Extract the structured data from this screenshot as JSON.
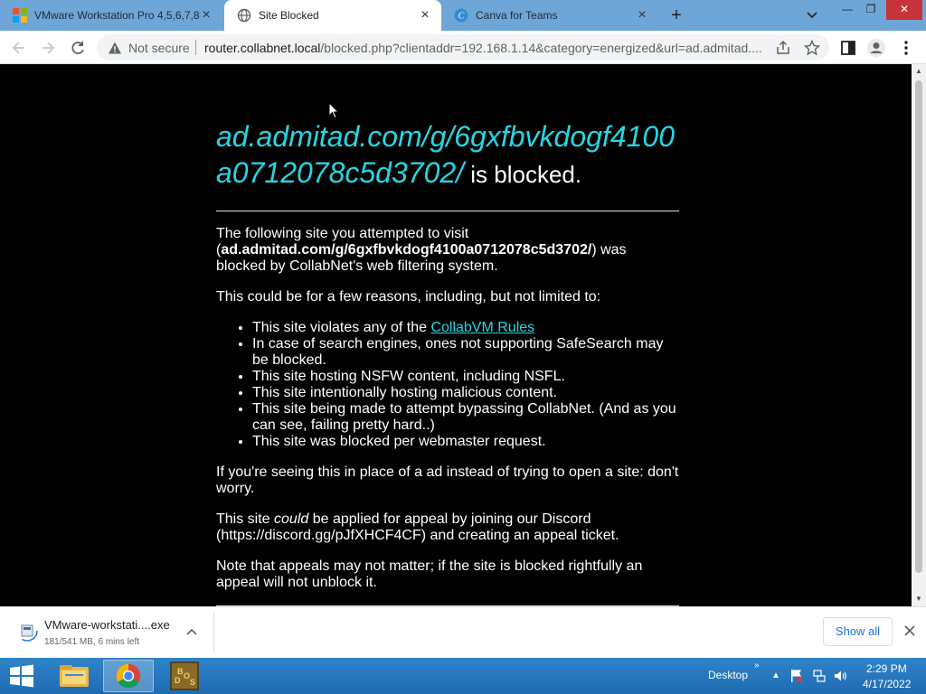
{
  "browser": {
    "tabs": [
      {
        "title": "VMware Workstation Pro 4,5,6,7,8",
        "active": false,
        "favicon": "vmware-icon"
      },
      {
        "title": "Site Blocked",
        "active": true,
        "favicon": "globe-icon"
      },
      {
        "title": "Canva for Teams",
        "active": false,
        "favicon": "canva-icon"
      }
    ],
    "new_tab_label": "+",
    "toolbar": {
      "not_secure_label": "Not secure",
      "url_host": "router.collabnet.local",
      "url_path": "/blocked.php?clientaddr=192.168.1.14&category=energized&url=ad.admitad...."
    }
  },
  "page": {
    "blocked_host": "ad.admitad.com/g/6gxfbvkdogf4100a0712078c5d3702/",
    "is_blocked_text": " is blocked.",
    "intro_before": "The following site you attempted to visit (",
    "intro_host": "ad.admitad.com/g/6gxfbvkdogf4100a0712078c5d3702/",
    "intro_after": ") was blocked by CollabNet's web filtering system.",
    "reasons_intro": "This could be for a few reasons, including, but not limited to:",
    "reason_rules_prefix": "This site violates any of the ",
    "reason_rules_link": "CollabVM Rules",
    "reasons": [
      "In case of search engines, ones not supporting SafeSearch may be blocked.",
      "This site hosting NSFW content, including NSFL.",
      "This site intentionally hosting malicious content.",
      "This site being made to attempt bypassing CollabNet. (And as you can see, failing pretty hard..)",
      "This site was blocked per webmaster request."
    ],
    "ad_note": "If you're seeing this in place of a ad instead of trying to open a site: don't worry.",
    "appeal_before": "This site ",
    "appeal_em": "could",
    "appeal_after": " be applied for appeal by joining our Discord (https://discord.gg/pJfXHCF4CF) and creating an appeal ticket.",
    "appeal_note": "Note that appeals may not matter; if the site is blocked rightfully an appeal will not unblock it."
  },
  "downloads": {
    "file_name": "VMware-workstati....exe",
    "status": "181/541 MB, 6 mins left",
    "show_all_label": "Show all"
  },
  "taskbar": {
    "desktop_label": "Desktop",
    "overflow_label": "»",
    "time": "2:29 PM",
    "date": "4/17/2022",
    "apps": [
      "file-explorer-icon",
      "chrome-icon",
      "dosbox-icon"
    ]
  },
  "colors": {
    "link": "#27d6e3",
    "tabstrip": "#6fa6d8",
    "taskbar": "#2f83c9"
  }
}
